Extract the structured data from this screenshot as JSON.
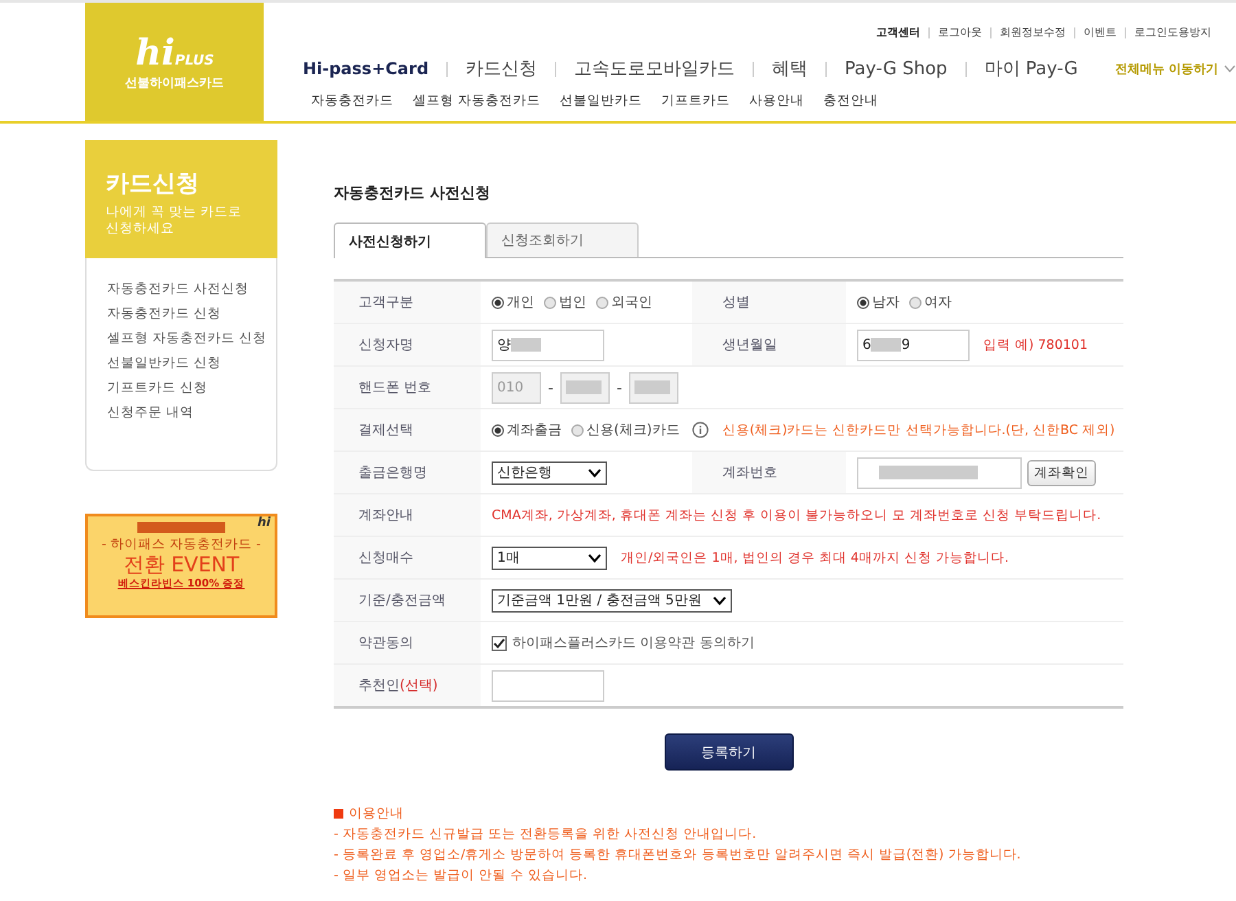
{
  "header": {
    "logo": {
      "mark": "hi",
      "plus": "PLUS",
      "subtitle": "선불하이패스카드"
    },
    "util_links": [
      "고객센터",
      "로그아웃",
      "회원정보수정",
      "이벤트",
      "로그인도용방지"
    ],
    "nav": [
      {
        "label": "Hi-pass+Card",
        "selected": true
      },
      {
        "label": "카드신청",
        "selected": false
      },
      {
        "label": "고속도로모바일카드",
        "selected": false
      },
      {
        "label": "혜택",
        "selected": false
      },
      {
        "label": "Pay-G Shop",
        "selected": false
      },
      {
        "label": "마이 Pay-G",
        "selected": false
      }
    ],
    "all_menu": "전체메뉴 이동하기",
    "subnav": [
      "자동충전카드",
      "셀프형 자동충전카드",
      "선불일반카드",
      "기프트카드",
      "사용안내",
      "충전안내"
    ]
  },
  "sidebar": {
    "title": "카드신청",
    "subtitle": "나에게 꼭 맞는 카드로\n신청하세요",
    "items": [
      "자동충전카드 사전신청",
      "자동충전카드 신청",
      "셀프형 자동충전카드 신청",
      "선불일반카드 신청",
      "기프트카드 신청",
      "신청주문 내역"
    ],
    "banner": {
      "top": "- 하이패스 자동충전카드 -",
      "main": "전환 EVENT",
      "bottom": "베스킨라빈스 100% 증정",
      "logo": "hi"
    }
  },
  "page_title": "자동충전카드 사전신청",
  "tabs": [
    {
      "label": "사전신청하기",
      "selected": true
    },
    {
      "label": "신청조회하기",
      "selected": false
    }
  ],
  "form_rows": [
    {
      "label": "고객구분",
      "fields": [
        {
          "kind": "radios",
          "options": [
            {
              "label": "개인",
              "selected": true
            },
            {
              "label": "법인",
              "selected": false
            },
            {
              "label": "외국인",
              "selected": false
            }
          ]
        }
      ],
      "pair": {
        "label": "성별",
        "fields": [
          {
            "kind": "radios",
            "options": [
              {
                "label": "남자",
                "selected": true
              },
              {
                "label": "여자",
                "selected": false
              }
            ]
          }
        ]
      }
    },
    {
      "label": "신청자명",
      "fields": [
        {
          "kind": "input",
          "value": "양",
          "redacted": true,
          "disabled": false
        }
      ],
      "pair": {
        "label": "생년월일",
        "fields": [
          {
            "kind": "input",
            "value": "6",
            "redacted": true,
            "value_end": "9",
            "disabled": false
          },
          {
            "kind": "note",
            "text": "입력 예) 780101",
            "color": "#e0302a"
          }
        ]
      }
    },
    {
      "label": "핸드폰 번호",
      "fields": [
        {
          "kind": "short_input",
          "value": "010",
          "redacted": false,
          "disabled": true
        },
        {
          "kind": "dash",
          "text": "-"
        },
        {
          "kind": "short_input",
          "redacted": true,
          "disabled": true
        },
        {
          "kind": "dash",
          "text": "-"
        },
        {
          "kind": "short_input",
          "redacted": true,
          "disabled": true
        }
      ]
    },
    {
      "label": "결제선택",
      "fields": [
        {
          "kind": "radios",
          "options": [
            {
              "label": "계좌출금",
              "selected": true
            },
            {
              "label": "신용(체크)카드",
              "selected": false
            }
          ]
        },
        {
          "kind": "info"
        },
        {
          "kind": "note",
          "text": "신용(체크)카드는 신한카드만 선택가능합니다.(단, 신한BC 제외)",
          "color": "#ef5d1c"
        }
      ]
    },
    {
      "label": "출금은행명",
      "fields": [
        {
          "kind": "select",
          "value": "신한은행"
        }
      ],
      "pair": {
        "label": "계좌번호",
        "fields": [
          {
            "kind": "wide_input",
            "redacted": true,
            "disabled": false
          },
          {
            "kind": "button",
            "text": "계좌확인"
          }
        ]
      }
    },
    {
      "label": "계좌안내",
      "fields": [
        {
          "kind": "note",
          "text": "CMA계좌, 가상계좌, 휴대폰 계좌는 신청 후 이용이 불가능하오니 모 계좌번호로 신청 부탁드립니다.",
          "color": "#e0302a"
        }
      ]
    },
    {
      "label": "신청매수",
      "fields": [
        {
          "kind": "select",
          "value": "1매"
        },
        {
          "kind": "note",
          "text": "개인/외국인은 1매, 법인의 경우 최대 4매까지 신청 가능합니다.",
          "color": "#e0302a"
        }
      ]
    },
    {
      "label": "기준/충전금액",
      "fields": [
        {
          "kind": "select",
          "value": "기준금액 1만원 / 충전금액 5만원"
        }
      ]
    },
    {
      "label": "약관동의",
      "fields": [
        {
          "kind": "checkbox",
          "label": "하이패스플러스카드 이용약관 동의하기",
          "checked": true
        }
      ]
    },
    {
      "label": "추천인",
      "label_note": "(선택)",
      "fields": [
        {
          "kind": "input",
          "redacted": false,
          "disabled": false
        }
      ]
    }
  ],
  "submit": "등록하기",
  "notice": {
    "title": "이용안내",
    "lines": [
      "- 자동충전카드 신규발급 또는 전환등록을 위한 사전신청 안내입니다.",
      "- 등록완료 후 영업소/휴게소 방문하여 등록한 휴대폰번호와 등록번호만 알려주시면 즉시 발급(전환) 가능합니다.",
      "- 일부 영업소는 발급이 안될 수 있습니다."
    ]
  }
}
